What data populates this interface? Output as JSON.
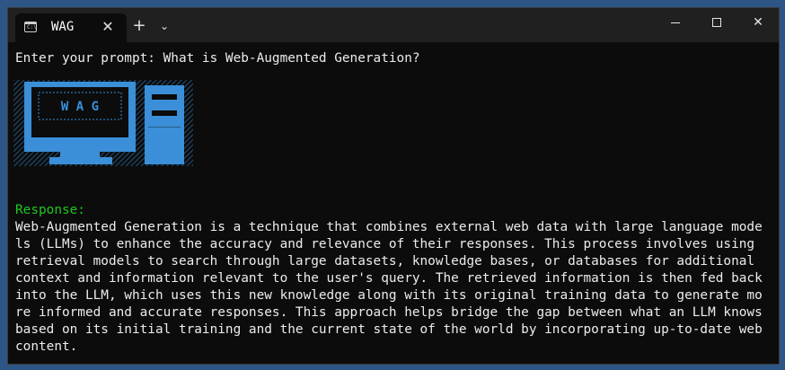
{
  "titlebar": {
    "tab_title": "WAG",
    "tab_icon": "terminal-icon",
    "tab_icon_text": "C:\\",
    "close_tab_symbol": "✕",
    "new_tab_symbol": "+",
    "dropdown_symbol": "⌄",
    "close_window_symbol": "✕"
  },
  "terminal": {
    "prompt_line": "Enter your prompt: What is Web-Augmented Generation?",
    "logo_text": "W A G",
    "response_label": "Response:",
    "response_text": "Web-Augmented Generation is a technique that combines external web data with large language models (LLMs) to enhance the accuracy and relevance of their responses. This process involves using retrieval models to search through large datasets, knowledge bases, or databases for additional context and information relevant to the user's query. The retrieved information is then fed back into the LLM, which uses this new knowledge along with its original training data to generate more informed and accurate responses. This approach helps bridge the gap between what an LLM knows based on its initial training and the current state of the world by incorporating up-to-date web content."
  },
  "colors": {
    "background": "#0c0c0c",
    "titlebar": "#202020",
    "response_label": "#1ec81e",
    "logo_blue": "#3a8fd8",
    "desktop": "#2d5585"
  }
}
